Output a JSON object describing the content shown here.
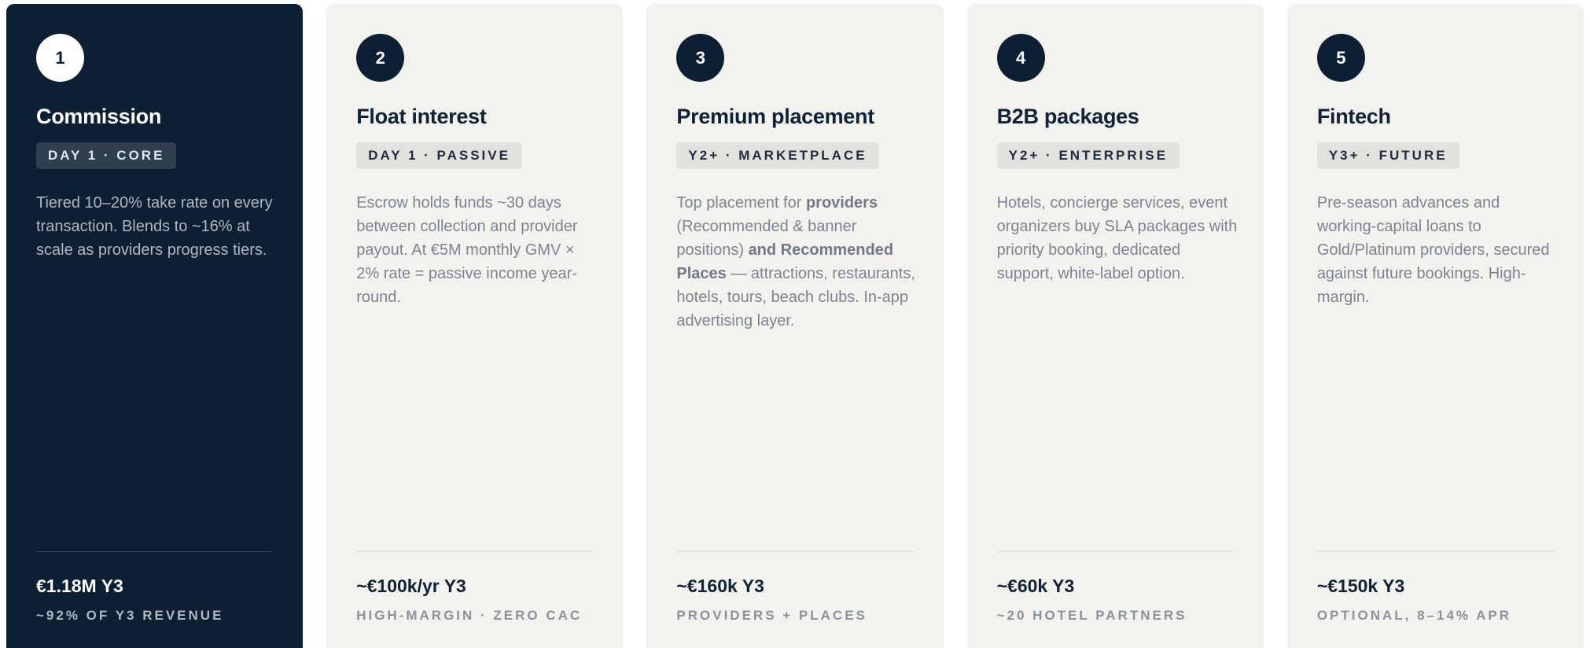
{
  "cards": [
    {
      "number": "1",
      "title": "Commission",
      "tag": "DAY 1 · CORE",
      "description": "Tiered 10–20% take rate on every transaction. Blends to ~16% at scale as providers progress tiers.",
      "metric": "€1.18M Y3",
      "subtext": "~92% OF Y3 REVENUE",
      "highlighted": true
    },
    {
      "number": "2",
      "title": "Float interest",
      "tag": "DAY 1 · PASSIVE",
      "description": "Escrow holds funds ~30 days between collection and provider payout. At €5M monthly GMV × 2% rate = passive income year-round.",
      "metric": "~€100k/yr Y3",
      "subtext": "HIGH-MARGIN · ZERO CAC",
      "highlighted": false
    },
    {
      "number": "3",
      "title": "Premium placement",
      "tag": "Y2+ · MARKETPLACE",
      "description": {
        "part1": "Top placement for ",
        "bold1": "providers",
        "part2": " (Recommended & banner positions) ",
        "bold2": "and Recommended Places",
        "part3": " — attractions, restaurants, hotels, tours, beach clubs. In-app advertising layer."
      },
      "metric": "~€160k Y3",
      "subtext": "PROVIDERS + PLACES",
      "highlighted": false
    },
    {
      "number": "4",
      "title": "B2B packages",
      "tag": "Y2+ · ENTERPRISE",
      "description": "Hotels, concierge services, event organizers buy SLA packages with priority booking, dedicated support, white-label option.",
      "metric": "~€60k Y3",
      "subtext": "~20 HOTEL PARTNERS",
      "highlighted": false
    },
    {
      "number": "5",
      "title": "Fintech",
      "tag": "Y3+ · FUTURE",
      "description": "Pre-season advances and working-capital loans to Gold/Platinum providers, secured against future bookings. High-margin.",
      "metric": "~€150k Y3",
      "subtext": "OPTIONAL, 8–14% APR",
      "highlighted": false
    }
  ],
  "colors": {
    "navy": "#0c1f33",
    "card_bg": "#f3f2ee",
    "tag_bg": "#e2e1dd",
    "muted_text": "#7b8592"
  }
}
